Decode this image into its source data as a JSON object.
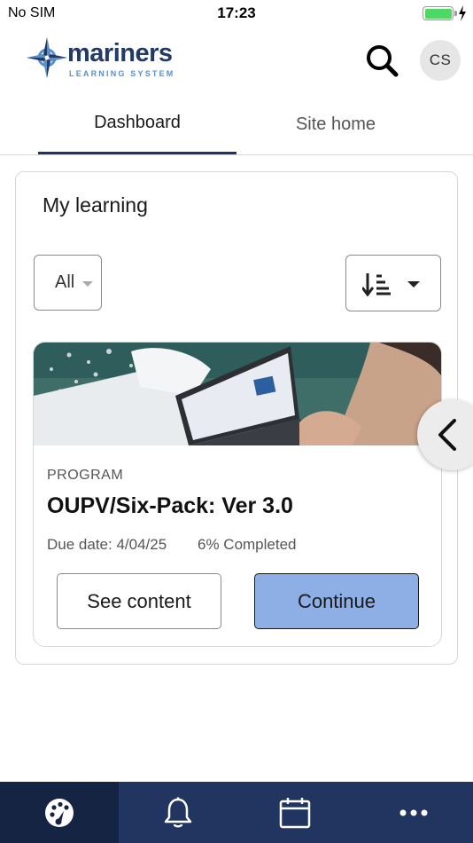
{
  "status_bar": {
    "carrier": "No SIM",
    "time": "17:23",
    "battery_color": "#4cd964"
  },
  "header": {
    "logo_word": "mariners",
    "logo_sub": "LEARNING SYSTEM",
    "avatar_initials": "CS",
    "icons": [
      "compass-logo-icon",
      "search-icon"
    ]
  },
  "tabs": [
    {
      "label": "Dashboard",
      "active": true
    },
    {
      "label": "Site home",
      "active": false
    }
  ],
  "my_learning": {
    "title": "My learning",
    "filter": {
      "selected": "All"
    },
    "sort_icon": "sort-descending-icon",
    "course": {
      "type": "PROGRAM",
      "title": "OUPV/Six-Pack: Ver 3.0",
      "due_date": "Due date: 4/04/25",
      "progress_text": "6% Completed",
      "progress_value": 6,
      "see_content_label": "See content",
      "continue_label": "Continue"
    }
  },
  "bottom_nav": {
    "items": [
      {
        "icon": "dashboard-gauge-icon",
        "active": true
      },
      {
        "icon": "bell-icon",
        "active": false
      },
      {
        "icon": "calendar-icon",
        "active": false
      },
      {
        "icon": "more-icon",
        "active": false
      }
    ],
    "colors": {
      "bar": "#213560",
      "active": "#162444"
    }
  },
  "colors": {
    "accent": "#1e3461",
    "continue_button": "#8eaee6",
    "brand_blue": "#5a8fc9"
  }
}
